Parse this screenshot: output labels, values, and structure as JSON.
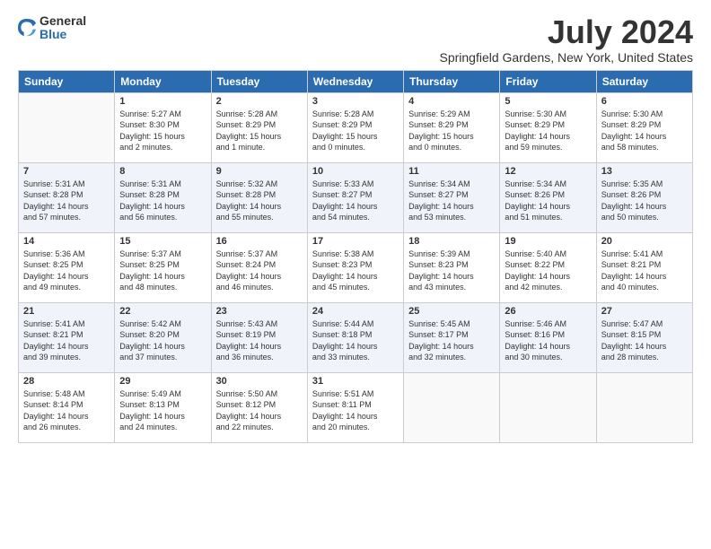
{
  "logo": {
    "general": "General",
    "blue": "Blue"
  },
  "title": "July 2024",
  "subtitle": "Springfield Gardens, New York, United States",
  "weekdays": [
    "Sunday",
    "Monday",
    "Tuesday",
    "Wednesday",
    "Thursday",
    "Friday",
    "Saturday"
  ],
  "weeks": [
    [
      {
        "day": "",
        "info": ""
      },
      {
        "day": "1",
        "info": "Sunrise: 5:27 AM\nSunset: 8:30 PM\nDaylight: 15 hours\nand 2 minutes."
      },
      {
        "day": "2",
        "info": "Sunrise: 5:28 AM\nSunset: 8:29 PM\nDaylight: 15 hours\nand 1 minute."
      },
      {
        "day": "3",
        "info": "Sunrise: 5:28 AM\nSunset: 8:29 PM\nDaylight: 15 hours\nand 0 minutes."
      },
      {
        "day": "4",
        "info": "Sunrise: 5:29 AM\nSunset: 8:29 PM\nDaylight: 15 hours\nand 0 minutes."
      },
      {
        "day": "5",
        "info": "Sunrise: 5:30 AM\nSunset: 8:29 PM\nDaylight: 14 hours\nand 59 minutes."
      },
      {
        "day": "6",
        "info": "Sunrise: 5:30 AM\nSunset: 8:29 PM\nDaylight: 14 hours\nand 58 minutes."
      }
    ],
    [
      {
        "day": "7",
        "info": "Sunrise: 5:31 AM\nSunset: 8:28 PM\nDaylight: 14 hours\nand 57 minutes."
      },
      {
        "day": "8",
        "info": "Sunrise: 5:31 AM\nSunset: 8:28 PM\nDaylight: 14 hours\nand 56 minutes."
      },
      {
        "day": "9",
        "info": "Sunrise: 5:32 AM\nSunset: 8:28 PM\nDaylight: 14 hours\nand 55 minutes."
      },
      {
        "day": "10",
        "info": "Sunrise: 5:33 AM\nSunset: 8:27 PM\nDaylight: 14 hours\nand 54 minutes."
      },
      {
        "day": "11",
        "info": "Sunrise: 5:34 AM\nSunset: 8:27 PM\nDaylight: 14 hours\nand 53 minutes."
      },
      {
        "day": "12",
        "info": "Sunrise: 5:34 AM\nSunset: 8:26 PM\nDaylight: 14 hours\nand 51 minutes."
      },
      {
        "day": "13",
        "info": "Sunrise: 5:35 AM\nSunset: 8:26 PM\nDaylight: 14 hours\nand 50 minutes."
      }
    ],
    [
      {
        "day": "14",
        "info": "Sunrise: 5:36 AM\nSunset: 8:25 PM\nDaylight: 14 hours\nand 49 minutes."
      },
      {
        "day": "15",
        "info": "Sunrise: 5:37 AM\nSunset: 8:25 PM\nDaylight: 14 hours\nand 48 minutes."
      },
      {
        "day": "16",
        "info": "Sunrise: 5:37 AM\nSunset: 8:24 PM\nDaylight: 14 hours\nand 46 minutes."
      },
      {
        "day": "17",
        "info": "Sunrise: 5:38 AM\nSunset: 8:23 PM\nDaylight: 14 hours\nand 45 minutes."
      },
      {
        "day": "18",
        "info": "Sunrise: 5:39 AM\nSunset: 8:23 PM\nDaylight: 14 hours\nand 43 minutes."
      },
      {
        "day": "19",
        "info": "Sunrise: 5:40 AM\nSunset: 8:22 PM\nDaylight: 14 hours\nand 42 minutes."
      },
      {
        "day": "20",
        "info": "Sunrise: 5:41 AM\nSunset: 8:21 PM\nDaylight: 14 hours\nand 40 minutes."
      }
    ],
    [
      {
        "day": "21",
        "info": "Sunrise: 5:41 AM\nSunset: 8:21 PM\nDaylight: 14 hours\nand 39 minutes."
      },
      {
        "day": "22",
        "info": "Sunrise: 5:42 AM\nSunset: 8:20 PM\nDaylight: 14 hours\nand 37 minutes."
      },
      {
        "day": "23",
        "info": "Sunrise: 5:43 AM\nSunset: 8:19 PM\nDaylight: 14 hours\nand 36 minutes."
      },
      {
        "day": "24",
        "info": "Sunrise: 5:44 AM\nSunset: 8:18 PM\nDaylight: 14 hours\nand 33 minutes."
      },
      {
        "day": "25",
        "info": "Sunrise: 5:45 AM\nSunset: 8:17 PM\nDaylight: 14 hours\nand 32 minutes."
      },
      {
        "day": "26",
        "info": "Sunrise: 5:46 AM\nSunset: 8:16 PM\nDaylight: 14 hours\nand 30 minutes."
      },
      {
        "day": "27",
        "info": "Sunrise: 5:47 AM\nSunset: 8:15 PM\nDaylight: 14 hours\nand 28 minutes."
      }
    ],
    [
      {
        "day": "28",
        "info": "Sunrise: 5:48 AM\nSunset: 8:14 PM\nDaylight: 14 hours\nand 26 minutes."
      },
      {
        "day": "29",
        "info": "Sunrise: 5:49 AM\nSunset: 8:13 PM\nDaylight: 14 hours\nand 24 minutes."
      },
      {
        "day": "30",
        "info": "Sunrise: 5:50 AM\nSunset: 8:12 PM\nDaylight: 14 hours\nand 22 minutes."
      },
      {
        "day": "31",
        "info": "Sunrise: 5:51 AM\nSunset: 8:11 PM\nDaylight: 14 hours\nand 20 minutes."
      },
      {
        "day": "",
        "info": ""
      },
      {
        "day": "",
        "info": ""
      },
      {
        "day": "",
        "info": ""
      }
    ]
  ]
}
